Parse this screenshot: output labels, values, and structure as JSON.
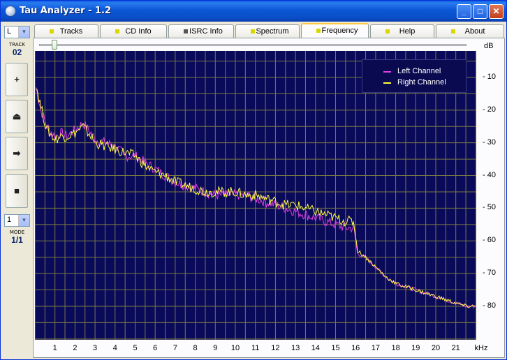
{
  "window": {
    "title": "Tau Analyzer - 1.2"
  },
  "titlebar_buttons": [
    "minimize",
    "maximize",
    "close"
  ],
  "left_toolbar": {
    "channel_select": "L",
    "track_label": "TRACK",
    "track_value": "02",
    "buttons": [
      {
        "name": "add",
        "glyph": "+"
      },
      {
        "name": "eject",
        "glyph": "⏏"
      },
      {
        "name": "play",
        "glyph": "➡"
      },
      {
        "name": "stop",
        "glyph": "■"
      }
    ],
    "mode_select": "1",
    "mode_label": "MODE",
    "mode_value": "1/1"
  },
  "tabs": [
    {
      "label": "Tracks",
      "indicator": "yellow",
      "active": false
    },
    {
      "label": "CD Info",
      "indicator": "yellow",
      "active": false
    },
    {
      "label": "ISRC Info",
      "indicator": "gray",
      "active": false
    },
    {
      "label": "Spectrum",
      "indicator": "yellow",
      "active": false
    },
    {
      "label": "Frequency",
      "indicator": "yellow",
      "active": true
    },
    {
      "label": "Help",
      "indicator": "yellow",
      "active": false
    },
    {
      "label": "About",
      "indicator": "yellow",
      "active": false
    }
  ],
  "zoom_slider": {
    "value_fraction": 0.05
  },
  "colors": {
    "plot_bg": "#0a0a5a",
    "grid": "#7a7a40",
    "left_channel": "#e040e0",
    "right_channel": "#ffff40"
  },
  "chart_data": {
    "type": "line",
    "ylabel_unit": "dB",
    "xlabel_unit": "kHz",
    "x_ticks": [
      1,
      2,
      3,
      4,
      5,
      6,
      7,
      8,
      9,
      10,
      11,
      12,
      13,
      14,
      15,
      16,
      17,
      18,
      19,
      20,
      21
    ],
    "y_ticks": [
      -10,
      -20,
      -30,
      -40,
      -50,
      -60,
      -70,
      -80
    ],
    "y_tick_labels": [
      "- 10",
      "- 20",
      "- 30",
      "- 40",
      "- 50",
      "- 60",
      "- 70",
      "- 80"
    ],
    "xlim": [
      0,
      22
    ],
    "ylim": [
      -90,
      0
    ],
    "grid": true,
    "legend_position": "top-right",
    "series": [
      {
        "name": "Left Channel",
        "color": "#e040e0",
        "points": [
          [
            0.05,
            -13
          ],
          [
            0.3,
            -20
          ],
          [
            0.6,
            -25
          ],
          [
            1.0,
            -28
          ],
          [
            1.3,
            -27
          ],
          [
            1.6,
            -28
          ],
          [
            2.0,
            -26
          ],
          [
            2.4,
            -24
          ],
          [
            2.8,
            -27
          ],
          [
            3.0,
            -29
          ],
          [
            3.5,
            -30
          ],
          [
            4.0,
            -31
          ],
          [
            4.5,
            -34
          ],
          [
            5.0,
            -34
          ],
          [
            5.5,
            -36
          ],
          [
            6.0,
            -38
          ],
          [
            6.5,
            -40
          ],
          [
            7.0,
            -42
          ],
          [
            7.5,
            -43
          ],
          [
            8.0,
            -44
          ],
          [
            8.5,
            -45
          ],
          [
            9.0,
            -46
          ],
          [
            9.5,
            -46
          ],
          [
            10.0,
            -46
          ],
          [
            10.5,
            -46
          ],
          [
            11.0,
            -47
          ],
          [
            11.5,
            -48
          ],
          [
            12.0,
            -49
          ],
          [
            12.5,
            -50
          ],
          [
            13.0,
            -51
          ],
          [
            13.5,
            -52
          ],
          [
            14.0,
            -53
          ],
          [
            14.5,
            -54
          ],
          [
            15.0,
            -55
          ],
          [
            15.5,
            -56
          ],
          [
            15.9,
            -56
          ],
          [
            16.1,
            -64
          ],
          [
            16.5,
            -65
          ],
          [
            17.0,
            -68
          ],
          [
            17.5,
            -71
          ],
          [
            18.0,
            -73
          ],
          [
            18.5,
            -74
          ],
          [
            19.0,
            -75
          ],
          [
            19.5,
            -76
          ],
          [
            20.0,
            -77
          ],
          [
            20.5,
            -78
          ],
          [
            21.0,
            -79
          ],
          [
            21.5,
            -80
          ],
          [
            22.0,
            -80
          ]
        ]
      },
      {
        "name": "Right Channel",
        "color": "#ffff40",
        "points": [
          [
            0.05,
            -12
          ],
          [
            0.3,
            -19
          ],
          [
            0.6,
            -26
          ],
          [
            1.0,
            -29
          ],
          [
            1.3,
            -28
          ],
          [
            1.6,
            -28
          ],
          [
            2.0,
            -27
          ],
          [
            2.4,
            -25
          ],
          [
            2.8,
            -28
          ],
          [
            3.0,
            -30
          ],
          [
            3.5,
            -31
          ],
          [
            4.0,
            -32
          ],
          [
            4.5,
            -33
          ],
          [
            5.0,
            -34
          ],
          [
            5.5,
            -37
          ],
          [
            6.0,
            -39
          ],
          [
            6.5,
            -40
          ],
          [
            7.0,
            -42
          ],
          [
            7.5,
            -43
          ],
          [
            8.0,
            -44
          ],
          [
            8.5,
            -45
          ],
          [
            9.0,
            -45
          ],
          [
            9.5,
            -45
          ],
          [
            10.0,
            -45
          ],
          [
            10.5,
            -46
          ],
          [
            11.0,
            -46
          ],
          [
            11.5,
            -47
          ],
          [
            12.0,
            -48
          ],
          [
            12.5,
            -49
          ],
          [
            13.0,
            -49
          ],
          [
            13.5,
            -50
          ],
          [
            14.0,
            -51
          ],
          [
            14.5,
            -52
          ],
          [
            15.0,
            -53
          ],
          [
            15.5,
            -54
          ],
          [
            15.9,
            -54
          ],
          [
            16.1,
            -63
          ],
          [
            16.5,
            -65
          ],
          [
            17.0,
            -68
          ],
          [
            17.5,
            -71
          ],
          [
            18.0,
            -73
          ],
          [
            18.5,
            -74
          ],
          [
            19.0,
            -75
          ],
          [
            19.5,
            -76
          ],
          [
            20.0,
            -77
          ],
          [
            20.5,
            -78
          ],
          [
            21.0,
            -79
          ],
          [
            21.5,
            -80
          ],
          [
            22.0,
            -80
          ]
        ]
      }
    ]
  }
}
